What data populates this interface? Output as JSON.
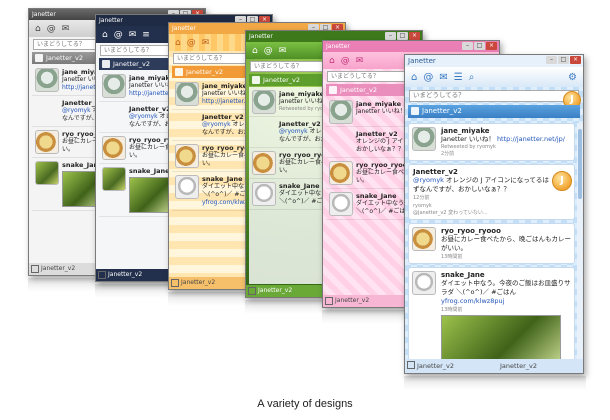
{
  "app_title": "Janetter",
  "tab_label": "Janetter_v2",
  "search_placeholder": "いまどうしてる？",
  "tweets": {
    "t1": {
      "name": "jane_miyake",
      "text": "Janetter いいね！",
      "link": "http://janetter.net/jp/",
      "retweet": "Retweeted by ryomyk",
      "count": "2分前"
    },
    "t2": {
      "name": "Janetter_v2",
      "mention": "@ryomyk",
      "text": "オレンジの J アイコンになってるはずなんですが、おかしいなぁ？？",
      "count": "12分前",
      "sub_user": "ryomyk",
      "sub_text": "@Janetter_v2 変わっていない..."
    },
    "t3": {
      "name": "ryo_ryoo_ryooo",
      "text": "お昼にカレー食べたから、晩ごはんもカレーがいい。",
      "count": "13時間前"
    },
    "t4": {
      "name": "snake_Jane",
      "text": "ダイエット中なう。今夜のご飯はお皿盛りサラダ ＼(^o^)／ #ごはん",
      "link": "yfrog.com/klwz8puj",
      "count": "13時間前"
    }
  },
  "front": {
    "status_left": "Janetter_v2",
    "status_right": "Janetter_v2"
  },
  "caption": "A variety of designs",
  "colors": {
    "grey": "#444444",
    "navy": "#1f2b44",
    "orange": "#f2a845",
    "green": "#3e7a1c",
    "pink": "#e97fb4",
    "blue": "#3a7fc4"
  },
  "icons": [
    "home-icon",
    "mention-icon",
    "mail-icon",
    "list-icon",
    "gear-icon",
    "j-badge-icon"
  ]
}
